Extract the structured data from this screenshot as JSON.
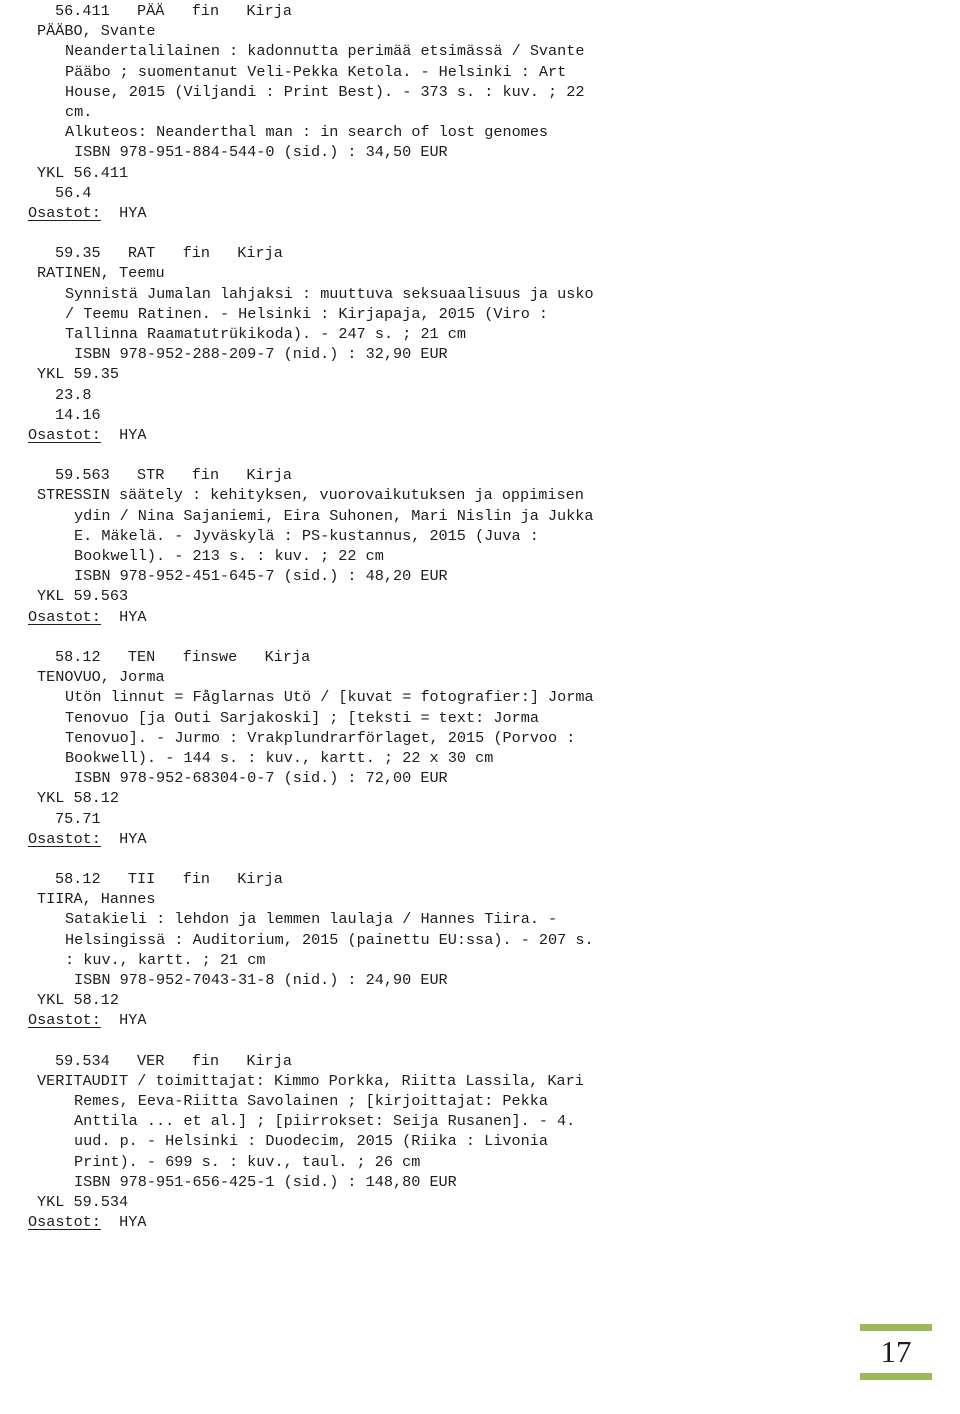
{
  "document": {
    "kind": "library-catalog-listing",
    "page_number": "17",
    "accent_color": "#9cb858",
    "text_color": "#1d1d1d",
    "background_color": "#ffffff"
  },
  "labels": {
    "osastot_label": "Osastot:"
  },
  "records": [
    {
      "header": "56.411   PÄÄ   fin   Kirja",
      "author": "PÄÄBO, Svante",
      "body": [
        "Neandertalilainen : kadonnutta perimää etsimässä / Svante",
        "Pääbo ; suomentanut Veli-Pekka Ketola. - Helsinki : Art",
        "House, 2015 (Viljandi : Print Best). - 373 s. : kuv. ; 22",
        "cm.",
        "Alkuteos: Neanderthal man : in search of lost genomes"
      ],
      "isbn": "ISBN 978-951-884-544-0 (sid.) : 34,50 EUR",
      "ykl": "YKL 56.411",
      "ykl_extra": [
        "56.4"
      ],
      "osastot_value": "HYA"
    },
    {
      "header": "59.35   RAT   fin   Kirja",
      "author": "RATINEN, Teemu",
      "body": [
        "Synnistä Jumalan lahjaksi : muuttuva seksuaalisuus ja usko",
        "/ Teemu Ratinen. - Helsinki : Kirjapaja, 2015 (Viro :",
        "Tallinna Raamatutrükikoda). - 247 s. ; 21 cm"
      ],
      "isbn": "ISBN 978-952-288-209-7 (nid.) : 32,90 EUR",
      "ykl": "YKL 59.35",
      "ykl_extra": [
        "23.8",
        "14.16"
      ],
      "osastot_value": "HYA"
    },
    {
      "header": "59.563   STR   fin   Kirja",
      "author": "STRESSIN säätely : kehityksen, vuorovaikutuksen ja oppimisen",
      "body": [
        "ydin / Nina Sajaniemi, Eira Suhonen, Mari Nislin ja Jukka",
        "E. Mäkelä. - Jyväskylä : PS-kustannus, 2015 (Juva :",
        "Bookwell). - 213 s. : kuv. ; 22 cm"
      ],
      "isbn": "ISBN 978-952-451-645-7 (sid.) : 48,20 EUR",
      "ykl": "YKL 59.563",
      "ykl_extra": [],
      "osastot_value": "HYA"
    },
    {
      "header": "58.12   TEN   finswe   Kirja",
      "author": "TENOVUO, Jorma",
      "body": [
        "Utön linnut = Fåglarnas Utö / [kuvat = fotografier:] Jorma",
        "Tenovuo [ja Outi Sarjakoski] ; [teksti = text: Jorma",
        "Tenovuo]. - Jurmo : Vrakplundrarförlaget, 2015 (Porvoo :",
        "Bookwell). - 144 s. : kuv., kartt. ; 22 x 30 cm"
      ],
      "isbn": "ISBN 978-952-68304-0-7 (sid.) : 72,00 EUR",
      "ykl": "YKL 58.12",
      "ykl_extra": [
        "75.71"
      ],
      "osastot_value": "HYA"
    },
    {
      "header": "58.12   TII   fin   Kirja",
      "author": "TIIRA, Hannes",
      "body": [
        "Satakieli : lehdon ja lemmen laulaja / Hannes Tiira. -",
        "Helsingissä : Auditorium, 2015 (painettu EU:ssa). - 207 s.",
        ": kuv., kartt. ; 21 cm"
      ],
      "isbn": "ISBN 978-952-7043-31-8 (nid.) : 24,90 EUR",
      "ykl": "YKL 58.12",
      "ykl_extra": [],
      "osastot_value": "HYA"
    },
    {
      "header": "59.534   VER   fin   Kirja",
      "author": "VERITAUDIT / toimittajat: Kimmo Porkka, Riitta Lassila, Kari",
      "body": [
        "Remes, Eeva-Riitta Savolainen ; [kirjoittajat: Pekka",
        "Anttila ... et al.] ; [piirrokset: Seija Rusanen]. - 4.",
        "uud. p. - Helsinki : Duodecim, 2015 (Riika : Livonia",
        "Print). - 699 s. : kuv., taul. ; 26 cm"
      ],
      "isbn": "ISBN 978-951-656-425-1 (sid.) : 148,80 EUR",
      "ykl": "YKL 59.534",
      "ykl_extra": [],
      "osastot_value": "HYA"
    }
  ]
}
